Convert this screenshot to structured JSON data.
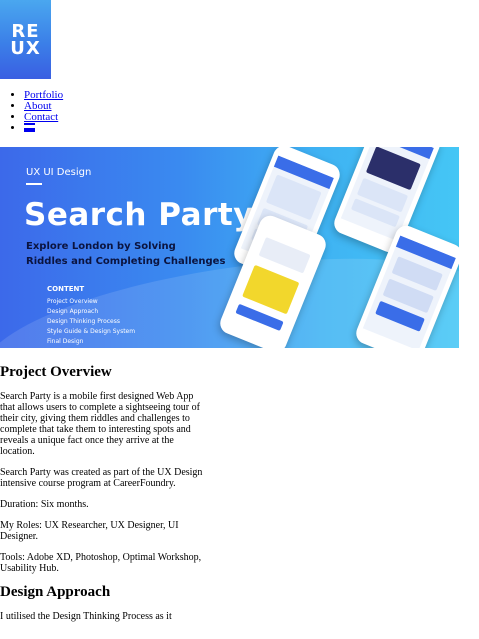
{
  "logo": {
    "line1": "RE",
    "line2": "UX"
  },
  "nav": {
    "items": [
      "Portfolio",
      "About",
      "Contact"
    ],
    "menu_icon": "hamburger-menu-icon"
  },
  "hero": {
    "kicker": "UX UI Design",
    "title": "Search Party",
    "subtitle_line1": "Explore London by Solving",
    "subtitle_line2": "Riddles and Completing Challenges",
    "content_title": "CONTENT",
    "content_items": [
      "Project Overview",
      "Design Approach",
      "Design Thinking Process",
      "Style Guide & Design System",
      "Final Design"
    ],
    "colors": {
      "gradient_start": "#3c69ea",
      "gradient_end": "#45c6f5",
      "subtitle": "#0b1440"
    }
  },
  "sections": {
    "overview": {
      "heading": "Project Overview",
      "paragraphs": [
        "Search Party is a mobile first designed Web App that allows users to complete a sightseeing tour of their city, giving them riddles and challenges to complete that take them to interesting spots and reveals a unique fact once they arrive at the location.",
        "Search Party was created as part of the UX Design intensive course program at CareerFoundry.",
        "Duration: Six months.",
        "My Roles: UX Researcher, UX Designer, UI Designer.",
        "Tools: Adobe XD, Photoshop, Optimal Workshop, Usability Hub."
      ]
    },
    "approach": {
      "heading": "Design Approach",
      "paragraph": "I utilised the Design Thinking Process as it"
    }
  }
}
